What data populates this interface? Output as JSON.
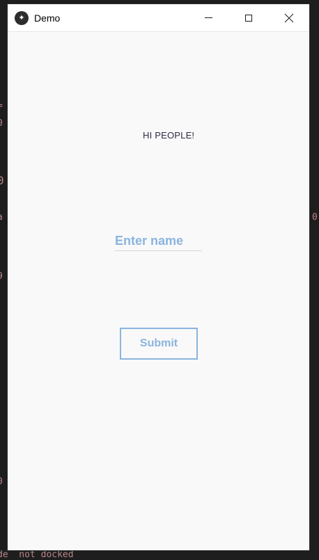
{
  "window": {
    "title": "Demo",
    "icon": "kivy-logo-icon",
    "controls": {
      "minimize": "minimize-icon",
      "maximize": "maximize-icon",
      "close": "close-icon"
    }
  },
  "content": {
    "greeting": "HI PEOPLE!",
    "name_input": {
      "placeholder": "Enter name",
      "value": ""
    },
    "submit_label": "Submit"
  },
  "background": {
    "status_text": "de  not docked"
  },
  "colors": {
    "accent": "#8ab4de",
    "window_bg": "#f9f9f9",
    "greeting_text": "#2f2b44"
  }
}
